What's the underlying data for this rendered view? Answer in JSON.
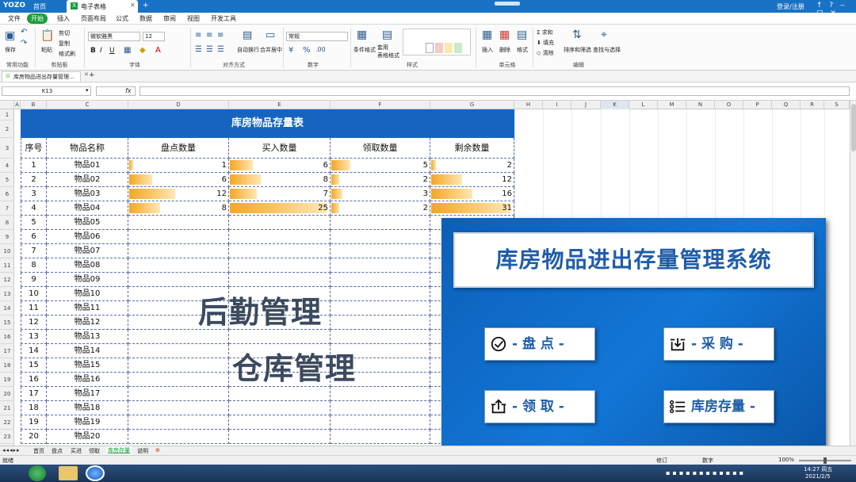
{
  "titlebar": {
    "logo": "YOZO",
    "home_tab": "首页",
    "doc_tab": "电子表格",
    "login": "登录/注册",
    "help_glyphs": "↑ ? ‒ □ ✕"
  },
  "menu": {
    "items": [
      "文件",
      "开始",
      "插入",
      "页面布局",
      "公式",
      "数据",
      "审阅",
      "视图",
      "开发工具"
    ],
    "active_index": 1
  },
  "ribbon": {
    "groups": [
      "常用功能",
      "剪贴板",
      "字体",
      "对齐方式",
      "数字",
      "样式",
      "单元格",
      "编辑"
    ],
    "save": "保存",
    "paste": "粘贴",
    "cut": "剪切",
    "copy": "复制",
    "format_painter": "格式刷",
    "font_name": "微软雅黑",
    "font_size": "12",
    "wrap": "自动换行",
    "merge": "合并居中",
    "number_format": "常规",
    "cond_format": "条件格式",
    "table_format": "套用\n表格格式",
    "insert": "插入",
    "delete": "删除",
    "format": "格式",
    "sum": "求和",
    "fill": "填充",
    "clear": "清除",
    "sort_filter": "排序和筛选",
    "find_select": "查找与选择",
    "bold": "B",
    "italic": "I",
    "underline": "U"
  },
  "doctab": {
    "label": "库房物品进出存量管理..."
  },
  "formula": {
    "cell_ref": "K13",
    "fx": "fx",
    "value": ""
  },
  "columns": [
    "A",
    "B",
    "C",
    "D",
    "E",
    "F",
    "G",
    "H",
    "I",
    "J",
    "K",
    "L",
    "M",
    "N",
    "O",
    "P",
    "Q",
    "R",
    "S"
  ],
  "rows": [
    "1",
    "2",
    "3",
    "4",
    "5",
    "6",
    "7",
    "8",
    "9",
    "10",
    "11",
    "12",
    "13",
    "14",
    "15",
    "16",
    "17",
    "18",
    "19",
    "20",
    "21",
    "22",
    "23"
  ],
  "sheet": {
    "title": "库房物品存量表",
    "headers": [
      "序号",
      "物品名称",
      "盘点数量",
      "买入数量",
      "领取数量",
      "剩余数量"
    ],
    "items": [
      {
        "no": "1",
        "name": "物品01",
        "count": 1,
        "buy": 6,
        "take": 5,
        "remain": 2
      },
      {
        "no": "2",
        "name": "物品02",
        "count": 6,
        "buy": 8,
        "take": 2,
        "remain": 12
      },
      {
        "no": "3",
        "name": "物品03",
        "count": 12,
        "buy": 7,
        "take": 3,
        "remain": 16
      },
      {
        "no": "4",
        "name": "物品04",
        "count": 8,
        "buy": 25,
        "take": 2,
        "remain": 31
      },
      {
        "no": "5",
        "name": "物品05"
      },
      {
        "no": "6",
        "name": "物品06"
      },
      {
        "no": "7",
        "name": "物品07"
      },
      {
        "no": "8",
        "name": "物品08"
      },
      {
        "no": "9",
        "name": "物品09"
      },
      {
        "no": "10",
        "name": "物品10"
      },
      {
        "no": "11",
        "name": "物品11"
      },
      {
        "no": "12",
        "name": "物品12"
      },
      {
        "no": "13",
        "name": "物品13"
      },
      {
        "no": "14",
        "name": "物品14"
      },
      {
        "no": "15",
        "name": "物品15"
      },
      {
        "no": "16",
        "name": "物品16"
      },
      {
        "no": "17",
        "name": "物品17"
      },
      {
        "no": "18",
        "name": "物品18"
      },
      {
        "no": "19",
        "name": "物品19"
      },
      {
        "no": "20",
        "name": "物品20"
      }
    ]
  },
  "watermark": {
    "line1": "后勤管理",
    "line2": "仓库管理"
  },
  "panel": {
    "title": "库房物品进出存量管理系统",
    "buttons": [
      {
        "label": "- 盘 点 -",
        "icon": "check-circle-icon"
      },
      {
        "label": "- 采 购 -",
        "icon": "inbox-in-icon"
      },
      {
        "label": "- 领 取 -",
        "icon": "inbox-out-icon"
      },
      {
        "label": "库房存量 -",
        "icon": "list-icon"
      }
    ]
  },
  "sheet_tabs": [
    "首页",
    "盘点",
    "买进",
    "领取",
    "库房存量",
    "说明"
  ],
  "active_sheet_index": 4,
  "status": {
    "ready": "就绪",
    "mode": "修订",
    "num": "数字",
    "zoom": "100%"
  },
  "clock": {
    "time": "14:27 周五",
    "date": "2021/2/5"
  },
  "colors": {
    "header_blue": "#1565c0",
    "panel_blue": "#1276d6",
    "bar_orange": "#f5a623",
    "title_text": "#1f5da8"
  }
}
